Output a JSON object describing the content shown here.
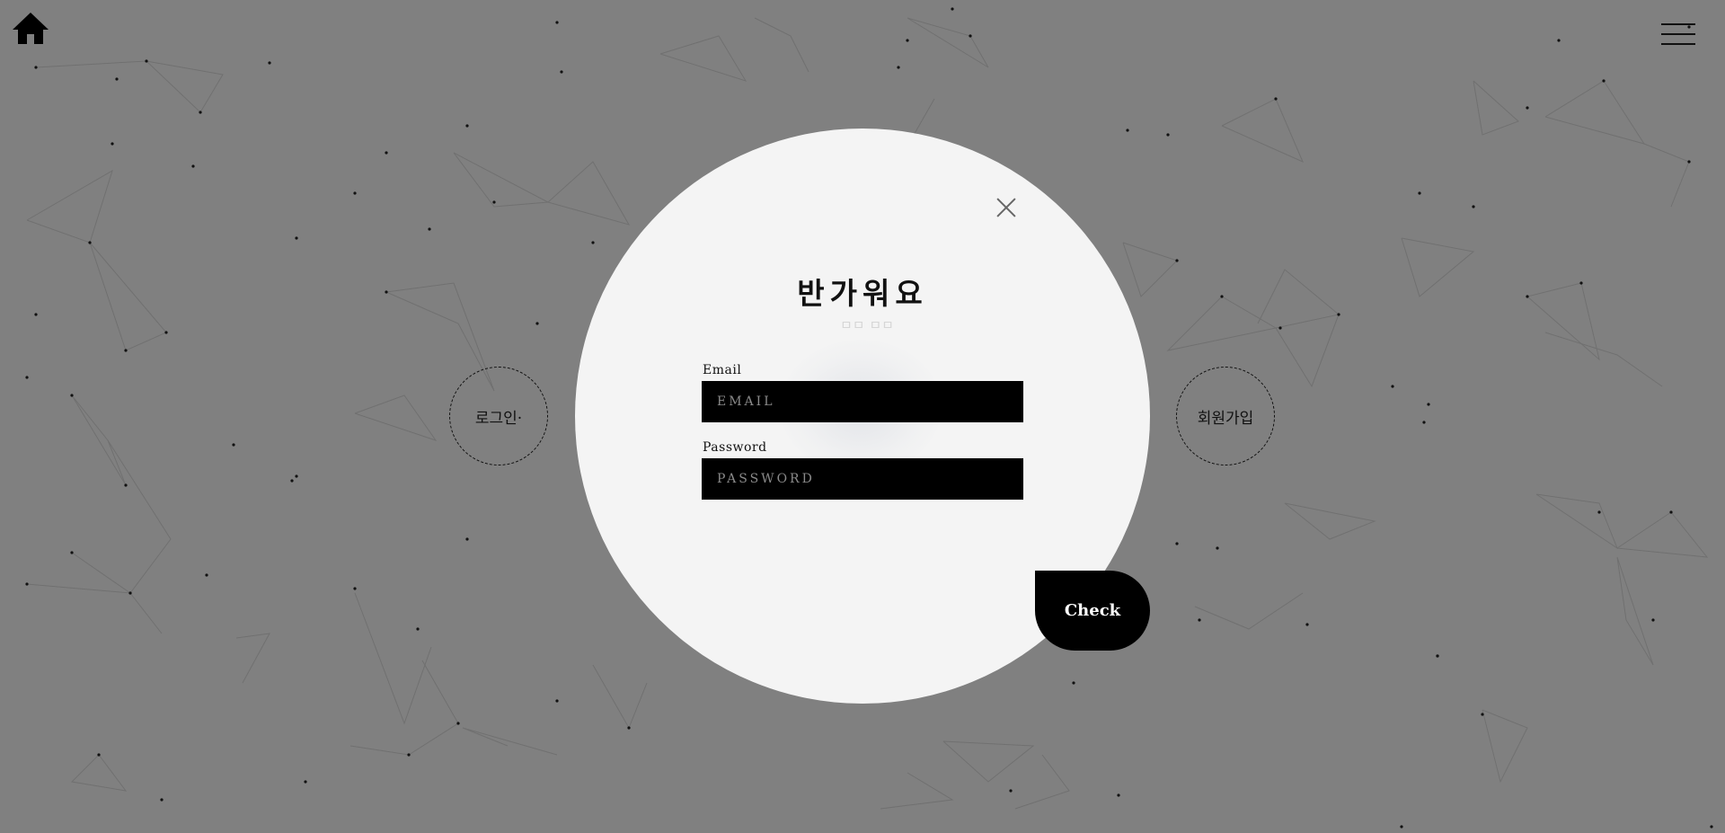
{
  "nav": {
    "home_icon": "home-icon",
    "menu_icon": "hamburger-menu-icon"
  },
  "side_buttons": {
    "login_label": "로그인·",
    "signup_label": "회원가입"
  },
  "modal": {
    "title": "반가워요",
    "background_label": "ㅁㅁ ㅁㅁ",
    "email": {
      "label": "Email",
      "placeholder": "EMAIL",
      "value": ""
    },
    "password": {
      "label": "Password",
      "placeholder": "PASSWORD",
      "value": ""
    },
    "submit_label": "Check",
    "close_icon": "close-icon"
  },
  "colors": {
    "background": "#808080",
    "modal_background": "#f4f4f4",
    "input_background": "#000000",
    "button_background": "#000000",
    "accent_text": "#111111"
  }
}
